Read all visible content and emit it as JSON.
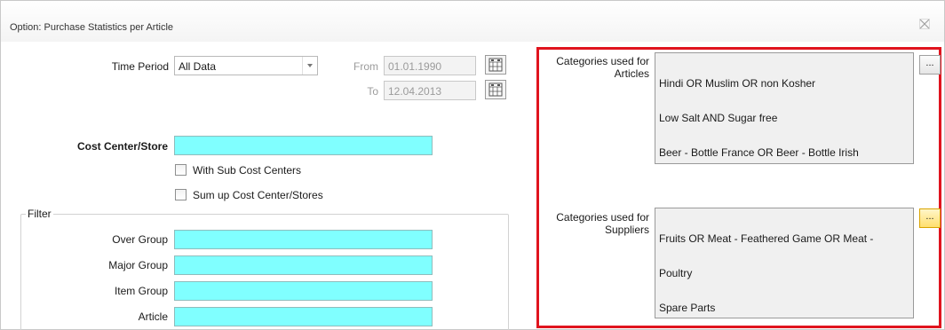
{
  "window": {
    "title": "Option: Purchase Statistics per Article",
    "close_icon": "close-icon"
  },
  "time_period": {
    "label": "Time Period",
    "selected": "All Data",
    "from_label": "From",
    "from_value": "01.01.1990",
    "to_label": "To",
    "to_value": "12.04.2013"
  },
  "cost_center": {
    "label": "Cost Center/Store",
    "value": "",
    "with_sub_label": "With Sub Cost Centers",
    "sum_up_label": "Sum up Cost Center/Stores"
  },
  "filter": {
    "legend": "Filter",
    "fields": [
      {
        "label": "Over Group",
        "value": ""
      },
      {
        "label": "Major Group",
        "value": ""
      },
      {
        "label": "Item Group",
        "value": ""
      },
      {
        "label": "Article",
        "value": ""
      }
    ]
  },
  "categories": {
    "articles_label_1": "Categories used for",
    "articles_label_2": "Articles",
    "articles_lines": [
      "Hindi OR Muslim OR non Kosher",
      "Low Salt AND Sugar free",
      "Beer - Bottle France OR Beer - Bottle Irish"
    ],
    "suppliers_label_1": "Categories used for",
    "suppliers_label_2": "Suppliers",
    "suppliers_lines": [
      "Fruits OR Meat - Feathered Game OR Meat -",
      "Poultry",
      "Spare Parts"
    ],
    "browse_label": "..."
  },
  "colors": {
    "required_field": "#80ffff",
    "highlight_frame": "#e0141e",
    "active_button": "#ffdf6e"
  }
}
